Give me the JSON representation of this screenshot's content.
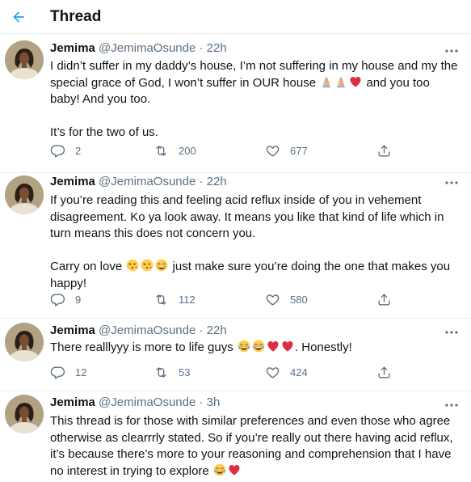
{
  "header": {
    "title": "Thread"
  },
  "colors": {
    "accent": "#1da1f2",
    "text": "#0f1419",
    "secondary": "#5b7083",
    "divider": "#ebeef0",
    "heart": "#e0245e"
  },
  "tweets": [
    {
      "name": "Jemima",
      "handle": "@JemimaOsunde",
      "sep": "·",
      "time": "22h",
      "paragraphs": [
        [
          "I didn’t suffer in my daddy’s house, I’m not suffering in my house and my the special grace of God, I won’t suffer in OUR house ",
          {
            "emoji": "pray"
          },
          {
            "emoji": "pray"
          },
          {
            "emoji": "heart"
          },
          " and you too baby! And you too."
        ],
        [
          "It’s for the two of us."
        ]
      ],
      "replies": "2",
      "retweets": "200",
      "likes": "677"
    },
    {
      "name": "Jemima",
      "handle": "@JemimaOsunde",
      "sep": "·",
      "time": "22h",
      "paragraphs": [
        [
          "If you’re reading this and feeling acid reflux inside of you in vehement disagreement. Ko ya look away. It means you like that kind of life which in turn means this does not concern you."
        ],
        [
          "Carry on love ",
          {
            "emoji": "kiss"
          },
          {
            "emoji": "kiss"
          },
          {
            "emoji": "grin"
          },
          " just make sure you’re doing the one that makes you happy!"
        ]
      ],
      "replies": "9",
      "retweets": "112",
      "likes": "580"
    },
    {
      "name": "Jemima",
      "handle": "@JemimaOsunde",
      "sep": "·",
      "time": "22h",
      "paragraphs": [
        [
          "There realllyyy is more to life guys ",
          {
            "emoji": "joy"
          },
          {
            "emoji": "joy"
          },
          {
            "emoji": "heart"
          },
          {
            "emoji": "heart"
          },
          ". Honestly!"
        ]
      ],
      "replies": "12",
      "retweets": "53",
      "likes": "424"
    },
    {
      "name": "Jemima",
      "handle": "@JemimaOsunde",
      "sep": "·",
      "time": "3h",
      "paragraphs": [
        [
          "This thread is for those with similar preferences and even those who agree otherwise as clearrrly stated. So if you’re really out there having acid reflux, it’s because there’s more to your reasoning and comprehension that I have no interest in trying to explore ",
          {
            "emoji": "joy"
          },
          {
            "emoji": "heart"
          }
        ]
      ],
      "replies": "",
      "retweets": "",
      "likes": ""
    }
  ],
  "icons": {
    "back": "arrow-left-icon",
    "more": "more-horizontal-icon",
    "reply": "reply-icon",
    "retweet": "retweet-icon",
    "like": "heart-outline-icon",
    "share": "share-icon"
  }
}
